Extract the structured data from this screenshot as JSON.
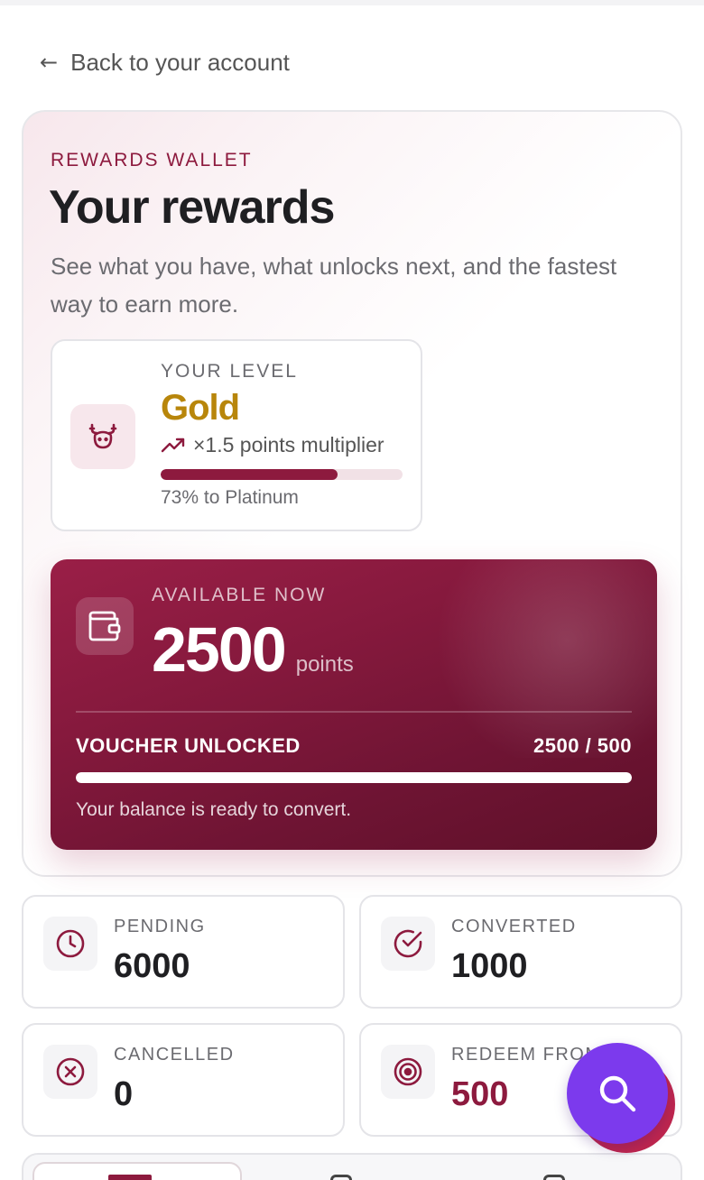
{
  "nav": {
    "back_label": "Back to your account",
    "back_icon": "arrow-left-icon"
  },
  "hero": {
    "eyebrow": "REWARDS WALLET",
    "title": "Your rewards",
    "subtitle": "See what you have, what unlocks next, and the fastest way to earn more."
  },
  "level": {
    "label": "YOUR LEVEL",
    "value": "Gold",
    "multiplier": "×1.5 points multiplier",
    "progress_percent": 73,
    "progress_note": "73% to Platinum",
    "icon": "deer-icon"
  },
  "balance": {
    "label": "AVAILABLE NOW",
    "points": "2500",
    "unit": "points",
    "voucher_label": "VOUCHER UNLOCKED",
    "voucher_count": "2500 / 500",
    "voucher_progress_percent": 100,
    "note": "Your balance is ready to convert.",
    "icon": "wallet-icon"
  },
  "stats": [
    {
      "label": "PENDING",
      "value": "6000",
      "icon": "clock-icon"
    },
    {
      "label": "CONVERTED",
      "value": "1000",
      "icon": "check-circle-icon"
    },
    {
      "label": "CANCELLED",
      "value": "0",
      "icon": "x-circle-icon"
    },
    {
      "label": "REDEEM FROM",
      "value": "500",
      "icon": "target-icon"
    }
  ],
  "fab": {
    "icon": "search-icon"
  },
  "colors": {
    "brand": "#8d1a3e",
    "gold": "#b8860b",
    "fab": "#7c3aed"
  }
}
